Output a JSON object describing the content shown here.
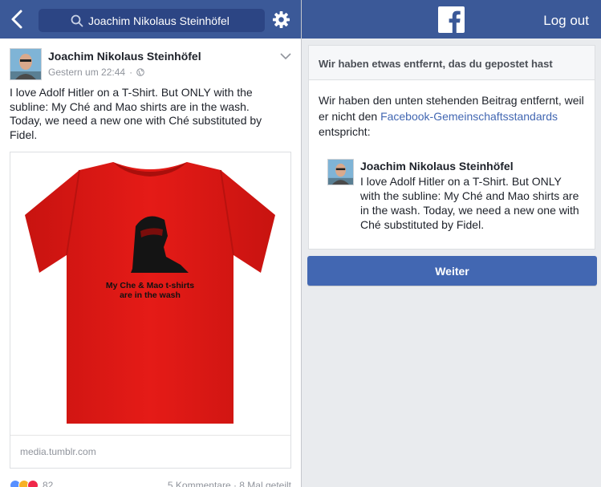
{
  "left_nav": {
    "search_value": "Joachim Nikolaus Steinhöfel"
  },
  "post": {
    "author": "Joachim Nikolaus Steinhöfel",
    "timestamp": "Gestern um 22:44",
    "separator": "·",
    "text": "I love Adolf Hitler on a T-Shirt. But ONLY with the subline: My Ché and Mao shirts are in the wash. Today, we need a new one with Ché substituted by Fidel.",
    "link": {
      "shirt_line1": "My Che & Mao t-shirts",
      "shirt_line2": "are in the wash",
      "domain": "media.tumblr.com"
    },
    "footer": {
      "reaction_count": "82",
      "comments_shares": "5 Kommentare · 8 Mal geteilt"
    }
  },
  "right_nav": {
    "logout_label": "Log out"
  },
  "notice": {
    "heading": "Wir haben etwas entfernt, das du gepostet hast",
    "body_pre": "Wir haben den unten stehenden Beitrag entfernt, weil er nicht den ",
    "body_link": "Facebook-Gemeinschaftsstandards",
    "body_post": " entspricht:",
    "quoted_author": "Joachim Nikolaus Steinhöfel",
    "quoted_text": "I love Adolf Hitler on a T-Shirt. But ONLY with the subline: My Ché and Mao shirts are in the wash. Today, we need a new one with Ché substituted by Fidel."
  },
  "continue_label": "Weiter",
  "colors": {
    "facebook_blue": "#3b5998",
    "button_blue": "#4267b2",
    "shirt_red": "#e51b17"
  }
}
